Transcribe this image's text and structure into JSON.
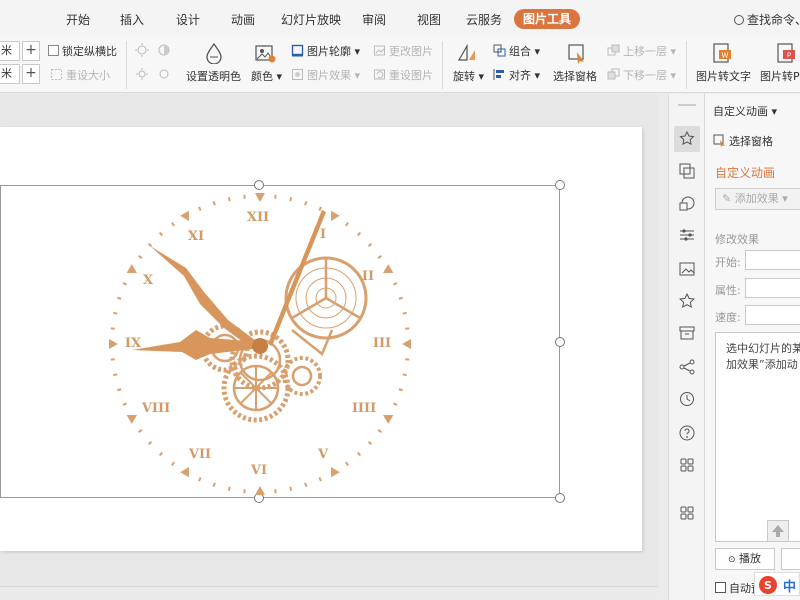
{
  "menu": {
    "tabs": [
      "开始",
      "插入",
      "设计",
      "动画",
      "幻灯片放映",
      "审阅",
      "视图",
      "云服务"
    ],
    "active_tab": "图片工具",
    "search_label": "查找命令、"
  },
  "ribbon": {
    "size": {
      "height_value": "米",
      "width_value": "米",
      "plus": "+",
      "lock_ratio": "锁定纵横比",
      "reset_size": "重设大小"
    },
    "set_transparent": "设置透明色",
    "color": "颜色",
    "outline": "图片轮廓",
    "effects": "图片效果",
    "change_picture": "更改图片",
    "reset_picture": "重设图片",
    "rotate": "旋转",
    "group": "组合",
    "align": "对齐",
    "selection_pane": "选择窗格",
    "bring_forward": "上移一层",
    "send_backward": "下移一层",
    "pic_to_text": "图片转文字",
    "pic_to_pdf": "图片转P"
  },
  "clock": {
    "numerals": [
      "XII",
      "I",
      "II",
      "III",
      "IIII",
      "V",
      "VI",
      "VII",
      "VIII",
      "IX",
      "X",
      "XI"
    ]
  },
  "task_pane": {
    "header": "自定义动画",
    "selection_pane": "选择窗格",
    "title": "自定义动画",
    "add_effect": "添加效果",
    "modify_effect": "修改效果",
    "start_label": "开始:",
    "property_label": "属性:",
    "speed_label": "速度:",
    "hint_line1": "选中幻灯片的某",
    "hint_line2": "加效果”添加动",
    "play": "播放",
    "auto_preview": "自动预"
  },
  "ime": {
    "label": "中"
  },
  "colors": {
    "accent": "#d9763f",
    "clock": "#d8a06e"
  }
}
